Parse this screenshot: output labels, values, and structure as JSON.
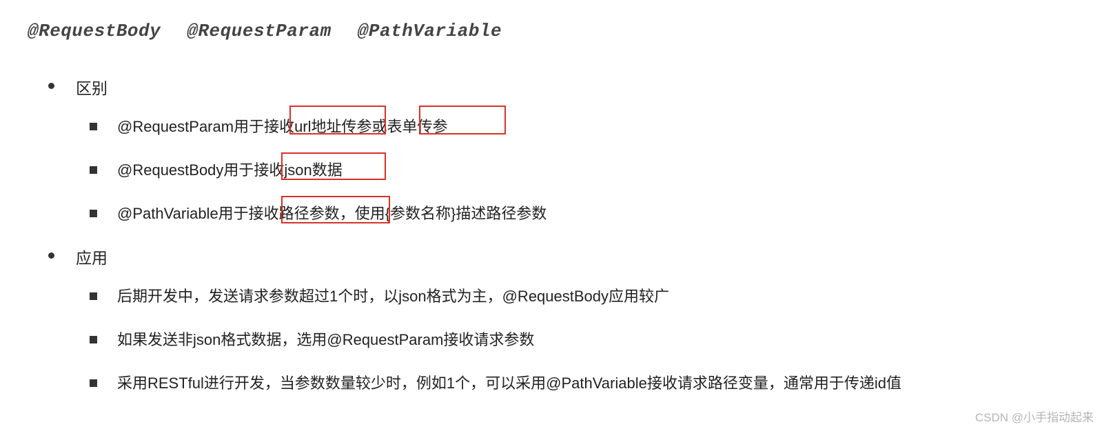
{
  "heading": {
    "a": "@RequestBody",
    "b": "@RequestParam",
    "c": "@PathVariable"
  },
  "sections": {
    "diff": {
      "label": "区别",
      "items": {
        "i0": "@RequestParam用于接收url地址传参或表单传参",
        "i1": "@RequestBody用于接收json数据",
        "i2_a": "@PathVariable用于接收路径参数",
        "i2_b": "，使用{参数名称}描述路径参数"
      }
    },
    "apply": {
      "label": "应用",
      "items": {
        "i0": "后期开发中，发送请求参数超过1个时，以json格式为主，@RequestBody应用较广",
        "i1": "如果发送非json格式数据，选用@RequestParam接收请求参数",
        "i2": "采用RESTful进行开发，当参数数量较少时，例如1个，可以采用@PathVariable接收请求路径变量，通常用于传递id值"
      }
    }
  },
  "watermark": "CSDN @小手指动起来"
}
